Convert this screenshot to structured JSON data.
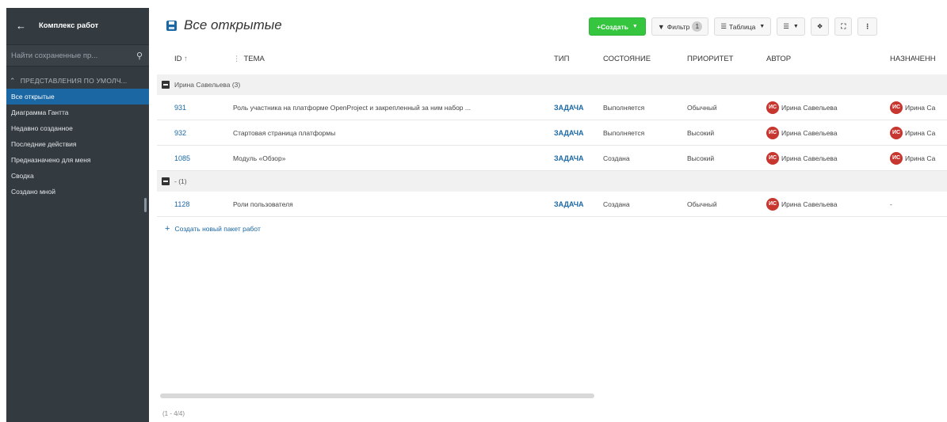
{
  "sidebar": {
    "title": "Комплекс работ",
    "search_placeholder": "Найти сохраненные пр...",
    "section": "ПРЕДСТАВЛЕНИЯ ПО УМОЛЧ...",
    "items": [
      {
        "label": "Все открытые",
        "active": true
      },
      {
        "label": "Диаграмма Гантта"
      },
      {
        "label": "Недавно созданное"
      },
      {
        "label": "Последние действия"
      },
      {
        "label": "Предназначено для меня"
      },
      {
        "label": "Сводка"
      },
      {
        "label": "Создано мной"
      }
    ]
  },
  "header": {
    "title": "Все открытые",
    "create": "+Создать",
    "filter": "Фильтр",
    "filter_count": "1",
    "table": "Таблица"
  },
  "columns": {
    "id": "ID",
    "theme": "ТЕМА",
    "type": "ТИП",
    "state": "СОСТОЯНИЕ",
    "priority": "ПРИОРИТЕТ",
    "author": "АВТОР",
    "assignee": "НАЗНАЧЕНН"
  },
  "groups": [
    {
      "label": "Ирина Савельева (3)"
    },
    {
      "label": "- (1)"
    }
  ],
  "rows": [
    {
      "id": "931",
      "theme": "Роль участника на платформе OpenProject и закрепленный за ним набор ...",
      "type": "ЗАДАЧА",
      "state": "Выполняется",
      "priority": "Обычный",
      "author_initials": "ИС",
      "author": "Ирина Савельева",
      "assignee_initials": "ИС",
      "assignee": "Ирина Са"
    },
    {
      "id": "932",
      "theme": "Стартовая страница платформы",
      "type": "ЗАДАЧА",
      "state": "Выполняется",
      "priority": "Высокий",
      "author_initials": "ИС",
      "author": "Ирина Савельева",
      "assignee_initials": "ИС",
      "assignee": "Ирина Са"
    },
    {
      "id": "1085",
      "theme": "Модуль «Обзор»",
      "type": "ЗАДАЧА",
      "state": "Создана",
      "priority": "Высокий",
      "author_initials": "ИС",
      "author": "Ирина Савельева",
      "assignee_initials": "ИС",
      "assignee": "Ирина Са"
    },
    {
      "id": "1128",
      "theme": "Роли пользователя",
      "type": "ЗАДАЧА",
      "state": "Создана",
      "priority": "Обычный",
      "author_initials": "ИС",
      "author": "Ирина Савельева",
      "assignee": "-"
    }
  ],
  "add_package": "Создать новый пакет работ",
  "pager": "(1 - 4/4)",
  "colors": {
    "sidebar_bg": "#333a40",
    "accent": "#1a67a3",
    "create_green": "#35c53f",
    "avatar_red": "#c7362f"
  }
}
